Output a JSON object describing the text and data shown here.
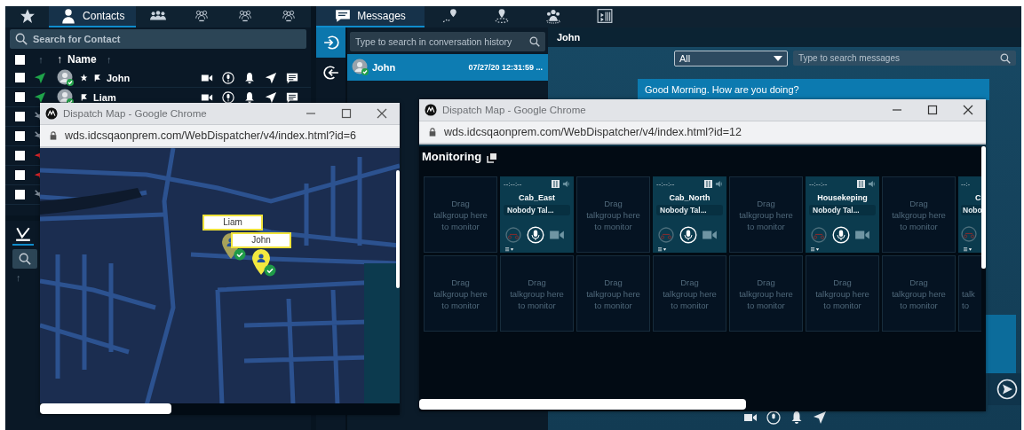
{
  "contacts_panel": {
    "tabs": [
      {
        "kind": "favorites",
        "selected": false
      },
      {
        "kind": "contacts",
        "label": "Contacts",
        "selected": true
      },
      {
        "kind": "groups",
        "selected": false
      },
      {
        "kind": "broadcast",
        "selected": false
      },
      {
        "kind": "dispatch",
        "selected": false
      },
      {
        "kind": "import",
        "selected": false
      }
    ],
    "search": {
      "placeholder": "Search for Contact"
    },
    "header": {
      "checked": false,
      "sort_arrow": "↑",
      "name_arrow": "↑",
      "name_label": "Name",
      "name_sort": "↑"
    },
    "rows": [
      {
        "name": "John",
        "favorite": true,
        "kind": "online",
        "checked": false
      },
      {
        "name": "Liam",
        "favorite": false,
        "kind": "online",
        "checked": false
      },
      {
        "kind": "offline",
        "checked": false
      },
      {
        "kind": "offline",
        "checked": false
      },
      {
        "kind": "emergency",
        "checked": false
      },
      {
        "kind": "emergency",
        "checked": false
      },
      {
        "kind": "offline",
        "checked": false
      }
    ]
  },
  "secondary_panel": {
    "sort_arrow": "↑"
  },
  "messages_panel": {
    "tabs": [
      {
        "kind": "messages",
        "label": "Messages",
        "selected": true
      },
      {
        "kind": "route",
        "selected": false
      },
      {
        "kind": "geofence",
        "selected": false
      },
      {
        "kind": "group",
        "selected": false
      },
      {
        "kind": "media",
        "selected": false
      }
    ],
    "side_buttons": [
      {
        "kind": "login",
        "selected": true
      },
      {
        "kind": "logout",
        "selected": false
      }
    ],
    "history_search": {
      "placeholder": "Type to search in conversation history"
    },
    "conversations": [
      {
        "name": "John",
        "time": "07/27/20 12:31:59 ...",
        "selected": true
      }
    ]
  },
  "chat": {
    "contact": "John",
    "filter": {
      "value": "All"
    },
    "search": {
      "placeholder": "Type to search messages"
    },
    "messages": [
      {
        "text": "Good Morning. How are you doing?"
      }
    ]
  },
  "map_window": {
    "title": "Dispatch Map - Google Chrome",
    "url": "wds.idcsqaonprem.com/WebDispatcher/v4/index.html?id=6",
    "markers": [
      {
        "label": "Liam",
        "kind": "faded"
      },
      {
        "label": "John",
        "kind": "active"
      }
    ]
  },
  "monitoring_window": {
    "title": "Dispatch Map - Google Chrome",
    "url": "wds.idcsqaonprem.com/WebDispatcher/v4/index.html?id=12",
    "heading": "Monitoring",
    "tile_rows": [
      {
        "tiles": [
          {
            "kind": "empty",
            "lines": [
              "Drag",
              "talkgroup here",
              "to monitor"
            ]
          },
          {
            "kind": "talkgroup",
            "timer": "--:--:--",
            "name": "Cab_East",
            "status": "Nobody Tal..."
          },
          {
            "kind": "empty",
            "lines": [
              "Drag",
              "talkgroup here",
              "to monitor"
            ]
          },
          {
            "kind": "talkgroup",
            "timer": "--:--:--",
            "name": "Cab_North",
            "status": "Nobody Tal..."
          },
          {
            "kind": "empty",
            "lines": [
              "Drag",
              "talkgroup here",
              "to monitor"
            ]
          },
          {
            "kind": "talkgroup",
            "timer": "--:--:--",
            "name": "Housekeping",
            "status": "Nobody Tal..."
          },
          {
            "kind": "empty",
            "lines": [
              "Drag",
              "talkgroup here",
              "to monitor"
            ]
          },
          {
            "kind": "talkgroup_cut",
            "timer": "--:-",
            "name": "C",
            "status": "Nobo"
          }
        ]
      },
      {
        "tiles": [
          {
            "kind": "empty",
            "lines": [
              "Drag",
              "talkgroup here",
              "to monitor"
            ]
          },
          {
            "kind": "empty",
            "lines": [
              "Drag",
              "talkgroup here",
              "to monitor"
            ]
          },
          {
            "kind": "empty",
            "lines": [
              "Drag",
              "talkgroup here",
              "to monitor"
            ]
          },
          {
            "kind": "empty",
            "lines": [
              "Drag",
              "talkgroup here",
              "to monitor"
            ]
          },
          {
            "kind": "empty",
            "lines": [
              "Drag",
              "talkgroup here",
              "to monitor"
            ]
          },
          {
            "kind": "empty",
            "lines": [
              "Drag",
              "talkgroup here",
              "to monitor"
            ]
          },
          {
            "kind": "empty",
            "lines": [
              "Drag",
              "talkgroup here",
              "to monitor"
            ]
          },
          {
            "kind": "empty_cut",
            "lines": [
              "talk",
              "to"
            ]
          }
        ]
      }
    ]
  }
}
